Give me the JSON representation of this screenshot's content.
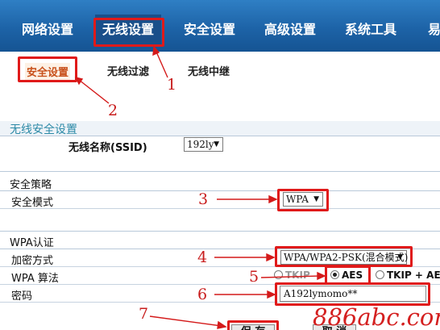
{
  "topnav": {
    "items": [
      "网络设置",
      "无线设置",
      "安全设置",
      "高级设置",
      "系统工具",
      "易"
    ]
  },
  "subtabs": [
    "安全设置",
    "无线过滤",
    "无线中继"
  ],
  "annotations": [
    "1",
    "2",
    "3",
    "4",
    "5",
    "6",
    "7"
  ],
  "wireless_security": {
    "title": "无线安全设置",
    "ssid_label": "无线名称(SSID)",
    "ssid_value": "192ly"
  },
  "security_policy": {
    "title": "安全策略",
    "mode_label": "安全模式",
    "mode_value": "WPA"
  },
  "wpa_auth": {
    "title": "WPA认证",
    "encryption_label": "加密方式",
    "encryption_value": "WPA/WPA2-PSK(混合模式)",
    "algorithm_label": "WPA 算法",
    "algorithm_options": [
      "TKIP",
      "AES",
      "TKIP + AE"
    ],
    "algorithm_selected": "AES",
    "password_label": "密码",
    "password_value": "A192lymomo**"
  },
  "buttons": {
    "save_label": "保 存",
    "cancel_label": "取 消"
  },
  "watermark": "886abc.com",
  "colors": {
    "nav_bg": "#1d63a7",
    "annotation_red": "#e01a1a",
    "section_title": "#2c8aa7"
  }
}
